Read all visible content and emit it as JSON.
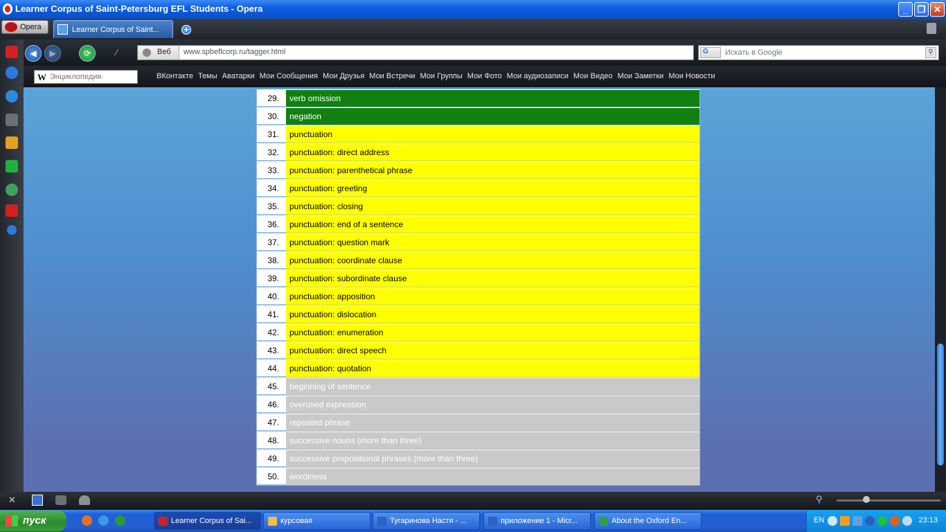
{
  "window": {
    "title": "Learner Corpus of Saint-Petersburg EFL Students - Opera"
  },
  "tabbar": {
    "menu_label": "Opera",
    "tab_title": "Learner Corpus of Saint..."
  },
  "nav": {
    "address_mode": "Веб",
    "url": "www.spbeflcorp.ru/tagger.html",
    "search_engine": "G",
    "search_placeholder": "Искать в Google"
  },
  "bookmarks": {
    "wiki_placeholder": "Энциклопедия",
    "links": [
      "ВКонтакте",
      "Темы",
      "Аватарки",
      "Мои Сообщения",
      "Мои Друзья",
      "Мои Встречи",
      "Мои Группы",
      "Мои Фото",
      "Мои аудиозаписи",
      "Мои Видео",
      "Мои Заметки",
      "Мои Новости"
    ]
  },
  "tags": [
    {
      "num": "29.",
      "label": "verb omission",
      "color": "green"
    },
    {
      "num": "30.",
      "label": "negation",
      "color": "green"
    },
    {
      "num": "31.",
      "label": "punctuation",
      "color": "yellow"
    },
    {
      "num": "32.",
      "label": "punctuation: direct address",
      "color": "yellow"
    },
    {
      "num": "33.",
      "label": "punctuation: parenthetical phrase",
      "color": "yellow"
    },
    {
      "num": "34.",
      "label": "punctuation: greeting",
      "color": "yellow"
    },
    {
      "num": "35.",
      "label": "punctuation: closing",
      "color": "yellow"
    },
    {
      "num": "36.",
      "label": "punctuation: end of a sentence",
      "color": "yellow"
    },
    {
      "num": "37.",
      "label": "punctuation: question mark",
      "color": "yellow"
    },
    {
      "num": "38.",
      "label": "punctuation: coordinate clause",
      "color": "yellow"
    },
    {
      "num": "39.",
      "label": "punctuation: subordinate clause",
      "color": "yellow"
    },
    {
      "num": "40.",
      "label": "punctuation: apposition",
      "color": "yellow"
    },
    {
      "num": "41.",
      "label": "punctuation: dislocation",
      "color": "yellow"
    },
    {
      "num": "42.",
      "label": "punctuation: enumeration",
      "color": "yellow"
    },
    {
      "num": "43.",
      "label": "punctuation: direct speech",
      "color": "yellow"
    },
    {
      "num": "44.",
      "label": "punctuation: quotation",
      "color": "yellow"
    },
    {
      "num": "45.",
      "label": "beginning of sentence",
      "color": "silver"
    },
    {
      "num": "46.",
      "label": "overused expression",
      "color": "silver"
    },
    {
      "num": "47.",
      "label": "repeated phrase",
      "color": "silver"
    },
    {
      "num": "48.",
      "label": "successive nouns (more than three)",
      "color": "silver"
    },
    {
      "num": "49.",
      "label": "successive prepositional phrases (more than three)",
      "color": "silver"
    },
    {
      "num": "50.",
      "label": "wordiness",
      "color": "silver"
    }
  ],
  "taskbar": {
    "start_label": "пуск",
    "tasks": [
      {
        "label": "Learner Corpus of Sai...",
        "color": "#d42020"
      },
      {
        "label": "курсовая",
        "color": "#f0c040"
      },
      {
        "label": "Тугаринова Настя - ...",
        "color": "#3060c0"
      },
      {
        "label": "приложение 1 - Micr...",
        "color": "#3060c0"
      },
      {
        "label": "About the Oxford En...",
        "color": "#30a040"
      }
    ],
    "lang": "EN",
    "clock": "23:13"
  },
  "colors": {
    "green": "#118011",
    "yellow": "#ffff00",
    "silver": "#c9c9c9"
  }
}
